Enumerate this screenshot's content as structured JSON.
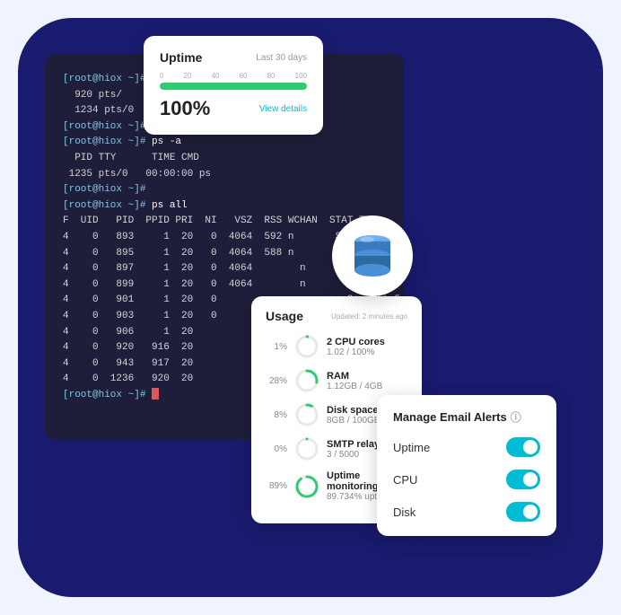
{
  "background": {
    "blob_color": "#1a1a6e"
  },
  "uptime_card": {
    "title": "Uptime",
    "subtitle": "Last 30 days",
    "scale": [
      "0",
      "20",
      "40",
      "60",
      "80",
      "100"
    ],
    "bar_width_percent": 100,
    "percent_label": "100%",
    "view_details_label": "View details"
  },
  "terminal": {
    "lines": [
      "[root@hiox ~]#",
      "  920 pts/",
      "  1234 pts/0   00:00:00 ps",
      "[root@hiox ~]#",
      "[root@hiox ~]# ps -a",
      "  PID TTY      TIME CMD",
      " 1235 pts/0   00:00:00 ps",
      "[root@hiox ~]#",
      "[root@hiox ~]# ps all",
      "F  UID   PID  PPID PRI  NI   VSZ  RSS WCHAN  STAT TTY",
      "4    0   893     1  20   0  4064  592",
      "4    0   895     1  20   0  4064  588",
      "4    0   897     1  20   0  4064",
      "4    0   899     1  20   0  4064",
      "4    0   901     1  20   0",
      "4    0   903     1  20   0",
      "4    0   906     1  20",
      "4    0   920  916  20",
      "4    0   943  917  20",
      "4    0  1236  920  20",
      "[root@hiox ~]#"
    ]
  },
  "db_icon": {
    "label": "Database"
  },
  "usage_card": {
    "title": "Usage",
    "updated": "Updated: 2 minutes ago",
    "items": [
      {
        "id": "cpu",
        "percent": "1%",
        "label": "2 CPU cores",
        "value": "1.02 / 100%",
        "circle_color": "#2ecc71",
        "stroke_percent": 1
      },
      {
        "id": "ram",
        "percent": "28%",
        "label": "RAM",
        "value": "1.12GB / 4GB",
        "circle_color": "#2ecc71",
        "stroke_percent": 28
      },
      {
        "id": "disk",
        "percent": "8%",
        "label": "Disk space",
        "value": "8GB / 100GB",
        "circle_color": "#2ecc71",
        "stroke_percent": 8
      },
      {
        "id": "smtp",
        "percent": "0%",
        "label": "SMTP relays",
        "value": "3 / 5000",
        "circle_color": "#2ecc71",
        "stroke_percent": 0
      },
      {
        "id": "uptime_mon",
        "percent": "89%",
        "label": "Uptime monitoring",
        "value": "89.734% uptime",
        "circle_color": "#2ecc71",
        "stroke_percent": 89
      }
    ]
  },
  "email_alerts": {
    "title": "Manage Email Alerts",
    "info_icon": "ⓘ",
    "rows": [
      {
        "label": "Uptime",
        "enabled": true
      },
      {
        "label": "CPU",
        "enabled": true
      },
      {
        "label": "Disk",
        "enabled": true
      }
    ]
  }
}
